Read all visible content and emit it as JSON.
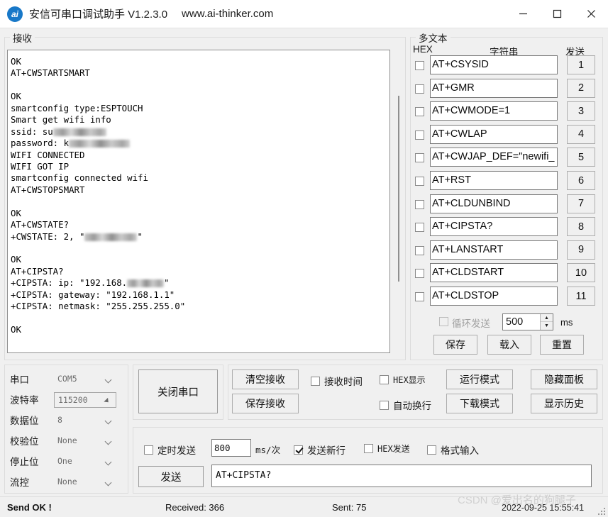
{
  "window": {
    "icon": "ai-logo-icon",
    "title": "安信可串口调试助手 V1.2.3.0",
    "url": "www.ai-thinker.com",
    "minimize": "minimize-icon",
    "maximize": "maximize-icon",
    "close": "close-icon"
  },
  "receive": {
    "group_label": "接收",
    "lines": [
      {
        "t": "OK"
      },
      {
        "t": "AT+CWSTARTSMART"
      },
      {
        "t": ""
      },
      {
        "t": "OK"
      },
      {
        "t": "smartconfig type:ESPTOUCH"
      },
      {
        "t": "Smart get wifi info"
      },
      {
        "t": "ssid: su",
        "redacted": 75
      },
      {
        "t": "password: k",
        "redacted": 86
      },
      {
        "t": "WIFI CONNECTED"
      },
      {
        "t": "WIFI GOT IP"
      },
      {
        "t": "smartconfig connected wifi"
      },
      {
        "t": "AT+CWSTOPSMART"
      },
      {
        "t": ""
      },
      {
        "t": "OK"
      },
      {
        "t": "AT+CWSTATE?"
      },
      {
        "t": "+CWSTATE: 2, \"",
        "redacted": 74,
        "suffix": "\""
      },
      {
        "t": ""
      },
      {
        "t": "OK"
      },
      {
        "t": "AT+CIPSTA?"
      },
      {
        "t": "+CIPSTA: ip: \"192.168.",
        "redacted": 52,
        "suffix": "\""
      },
      {
        "t": "+CIPSTA: gateway: \"192.168.1.1\""
      },
      {
        "t": "+CIPSTA: netmask: \"255.255.255.0\""
      },
      {
        "t": ""
      },
      {
        "t": "OK"
      }
    ]
  },
  "multitext": {
    "group_label": "多文本",
    "col_hex": "HEX",
    "col_string": "字符串",
    "col_send": "发送",
    "rows": [
      {
        "hex_checked": false,
        "command": "AT+CSYSID",
        "send_label": "1"
      },
      {
        "hex_checked": false,
        "command": "AT+GMR",
        "send_label": "2"
      },
      {
        "hex_checked": false,
        "command": "AT+CWMODE=1",
        "send_label": "3"
      },
      {
        "hex_checked": false,
        "command": "AT+CWLAP",
        "send_label": "4"
      },
      {
        "hex_checked": false,
        "command": "AT+CWJAP_DEF=\"newifi_",
        "send_label": "5"
      },
      {
        "hex_checked": false,
        "command": "AT+RST",
        "send_label": "6"
      },
      {
        "hex_checked": false,
        "command": "AT+CLDUNBIND",
        "send_label": "7"
      },
      {
        "hex_checked": false,
        "command": "AT+CIPSTA?",
        "send_label": "8"
      },
      {
        "hex_checked": false,
        "command": "AT+LANSTART",
        "send_label": "9"
      },
      {
        "hex_checked": false,
        "command": "AT+CLDSTART",
        "send_label": "10"
      },
      {
        "hex_checked": false,
        "command": "AT+CLDSTOP",
        "send_label": "11"
      }
    ],
    "loop_send": {
      "label": "循环发送",
      "checked": false,
      "enabled": false
    },
    "interval_value": "500",
    "interval_unit": "ms",
    "save_label": "保存",
    "load_label": "载入",
    "reset_label": "重置"
  },
  "serial": {
    "fields": [
      {
        "label": "串口",
        "value": "COM5",
        "chevron": "chevron-down-icon",
        "boxed": false
      },
      {
        "label": "波特率",
        "value": "115200",
        "chevron": "chevron-down-solid-icon",
        "boxed": true
      },
      {
        "label": "数据位",
        "value": "8",
        "chevron": "chevron-down-icon",
        "boxed": false
      },
      {
        "label": "校验位",
        "value": "None",
        "chevron": "chevron-down-icon",
        "boxed": false
      },
      {
        "label": "停止位",
        "value": "One",
        "chevron": "chevron-down-icon",
        "boxed": false
      },
      {
        "label": "流控",
        "value": "None",
        "chevron": "chevron-down-icon",
        "boxed": false
      }
    ],
    "close_port_label": "关闭串口"
  },
  "middle": {
    "clear_receive": "清空接收",
    "save_receive": "保存接收",
    "recv_time": {
      "label": "接收时间",
      "checked": false
    },
    "hex_show": {
      "label": "HEX显示",
      "checked": false
    },
    "auto_wrap": {
      "label": "自动换行",
      "checked": false
    },
    "run_mode": "运行模式",
    "download_mode": "下载模式",
    "hide_panel": "隐藏面板",
    "show_history": "显示历史"
  },
  "sendbar": {
    "timed_send": {
      "label": "定时发送",
      "checked": false
    },
    "interval_value": "800",
    "interval_unit": "ms/次",
    "send_newline": {
      "label": "发送新行",
      "checked": true
    },
    "hex_send": {
      "label": "HEX发送",
      "checked": false
    },
    "format_input": {
      "label": "格式输入",
      "checked": false
    },
    "send_button": "发送",
    "input_value": "AT+CIPSTA?"
  },
  "status": {
    "state": "Send OK !",
    "received": "Received: 366",
    "sent": "Sent: 75",
    "timestamp": "2022-09-25 15:55:41",
    "watermark_prefix": "CSDN ",
    "watermark_user": "@爱出名的狗腿子"
  }
}
